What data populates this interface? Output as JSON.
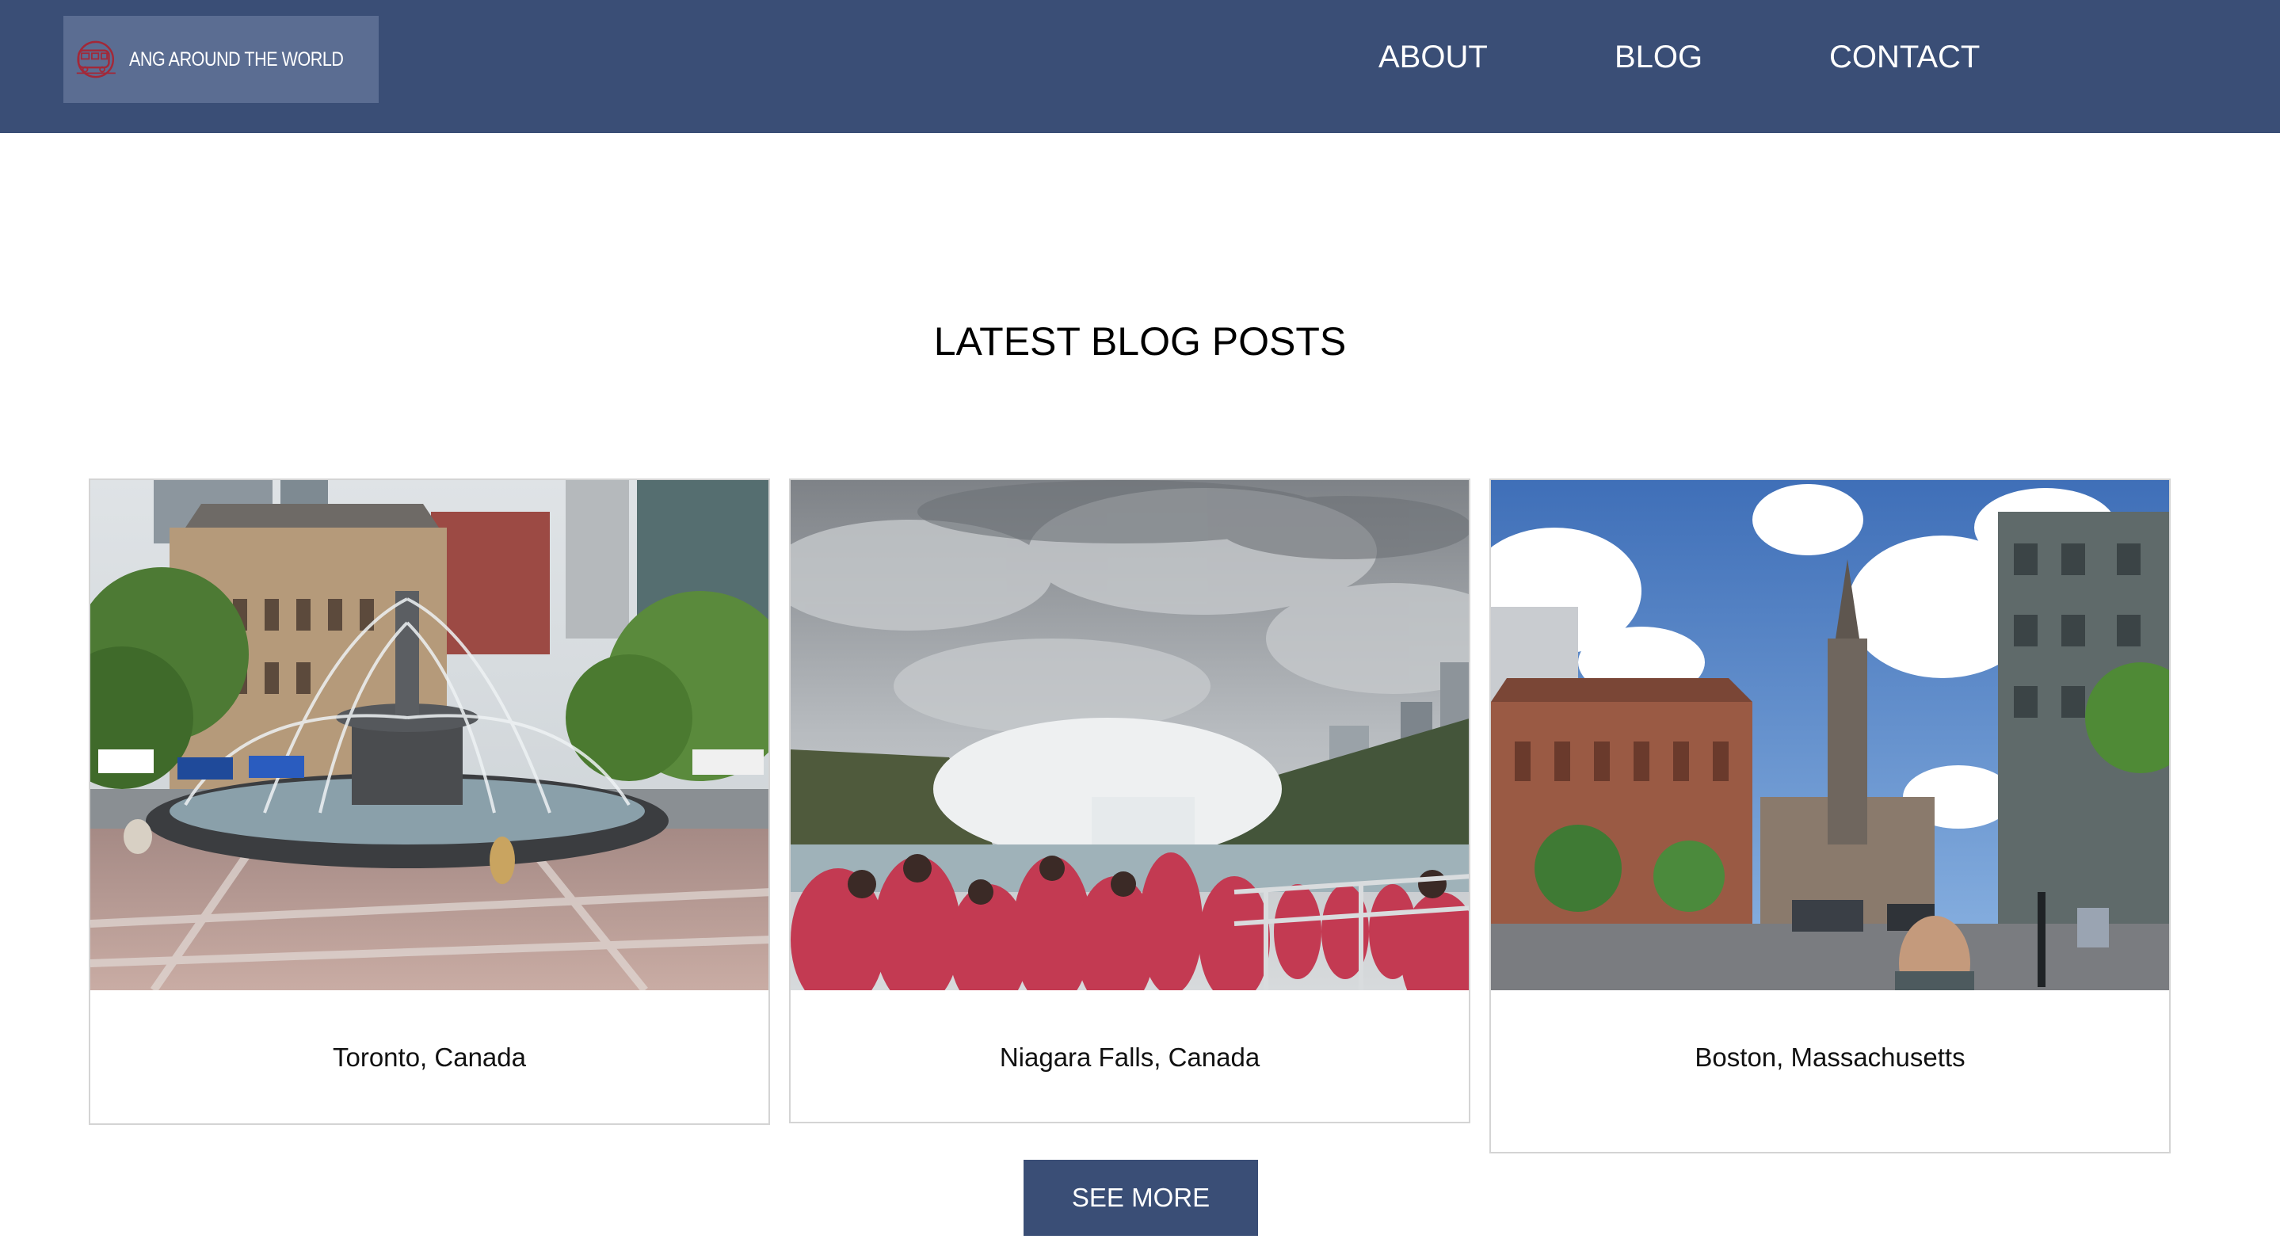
{
  "header": {
    "logo_text": "ANG AROUND THE WORLD",
    "nav": [
      {
        "label": "ABOUT"
      },
      {
        "label": "BLOG"
      },
      {
        "label": "CONTACT"
      }
    ]
  },
  "main": {
    "title": "LATEST BLOG POSTS",
    "posts": [
      {
        "caption": "Toronto, Canada",
        "image": "fountain-plaza-photo"
      },
      {
        "caption": "Niagara Falls, Canada",
        "image": "waterfall-boat-photo"
      },
      {
        "caption": "Boston, Massachusetts",
        "image": "city-street-church-photo"
      }
    ],
    "see_more_label": "SEE MORE"
  },
  "colors": {
    "header_bg": "#3a4e76",
    "logo_bg": "#5b6d92",
    "logo_icon": "#a32838",
    "button_bg": "#3a4e76"
  }
}
